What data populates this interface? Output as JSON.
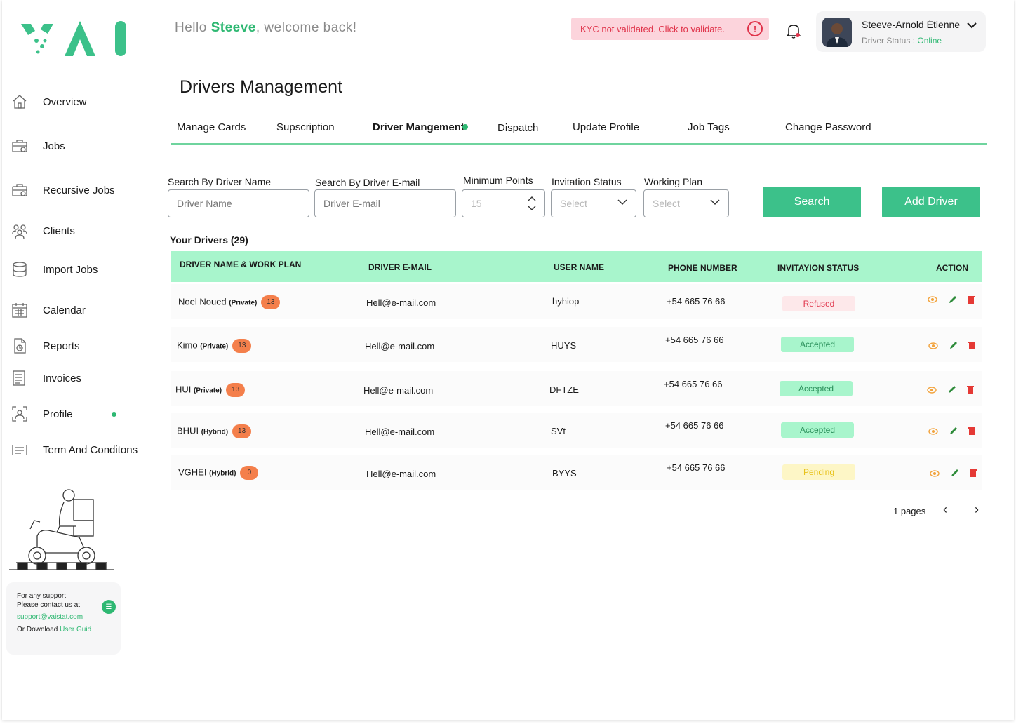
{
  "brand": {
    "logo_text": "VAI",
    "colors": {
      "accent": "#2eb872",
      "accent_light": "#a8f5cc",
      "button": "#3cc18a",
      "danger": "#e0334a",
      "warning_bg": "#fcd4dc"
    }
  },
  "sidebar": {
    "items": [
      {
        "label": "Overview",
        "icon": "home-icon"
      },
      {
        "label": "Jobs",
        "icon": "briefcase-icon"
      },
      {
        "label": "Recursive Jobs",
        "icon": "recurring-briefcase-icon"
      },
      {
        "label": "Clients",
        "icon": "users-icon"
      },
      {
        "label": "Import Jobs",
        "icon": "database-icon"
      },
      {
        "label": "Calendar",
        "icon": "calendar-icon"
      },
      {
        "label": "Reports",
        "icon": "report-icon"
      },
      {
        "label": "Invoices",
        "icon": "invoice-icon"
      },
      {
        "label": "Profile",
        "icon": "profile-icon"
      },
      {
        "label": "Term And Conditons",
        "icon": "terms-icon"
      }
    ],
    "support": {
      "line1": "For any support",
      "line2": "Please contact us at",
      "email": "support@vaistat.com",
      "download_prefix": "Or Download",
      "download_link": "User Guid"
    }
  },
  "header": {
    "greeting_prefix": "Hello ",
    "user_first_name": "Steeve",
    "greeting_suffix": ", welcome back!",
    "kyc_text": "KYC not validated. Click to validate.",
    "kyc_icon": "!",
    "profile": {
      "name": "Steeve-Arnold Étienne",
      "status_label": "Driver Status : ",
      "status_value": "Online"
    }
  },
  "page": {
    "title": "Drivers Management",
    "tabs": [
      {
        "label": "Manage Cards"
      },
      {
        "label": "Supscription"
      },
      {
        "label": "Driver Mangement",
        "active": true
      },
      {
        "label": "Dispatch"
      },
      {
        "label": "Update Profile"
      },
      {
        "label": "Job Tags"
      },
      {
        "label": "Change Password"
      }
    ]
  },
  "filters": {
    "driver_name": {
      "label": "Search By Driver Name",
      "placeholder": "Driver Name"
    },
    "driver_email": {
      "label": "Search By Driver E-mail",
      "placeholder": "Driver E-mail"
    },
    "min_points": {
      "label": "Minimum Points",
      "value": "15"
    },
    "invitation_status": {
      "label": "Invitation Status",
      "selected": "Select"
    },
    "working_plan": {
      "label": "Working Plan",
      "selected": "Select"
    },
    "search_button": "Search",
    "add_button": "Add Driver"
  },
  "table": {
    "title": "Your Drivers (29)",
    "headers": [
      "DRIVER NAME & WORK PLAN",
      "DRIVER E-MAIL",
      "USER NAME",
      "PHONE NUMBER",
      "INVITAYION STATUS",
      "ACTION"
    ],
    "rows": [
      {
        "name": "Noel Noued",
        "plan": "(Private)",
        "points": "13",
        "email": "Hell@e-mail.com",
        "username": "hyhiop",
        "phone": "+54 665 76 66",
        "status": "Refused"
      },
      {
        "name": "Kimo",
        "plan": "(Private)",
        "points": "13",
        "email": "Hell@e-mail.com",
        "username": "HUYS",
        "phone": "+54 665 76 66",
        "status": "Accepted"
      },
      {
        "name": "HUI",
        "plan": "(Private)",
        "points": "13",
        "email": "Hell@e-mail.com",
        "username": "DFTZE",
        "phone": "+54 665 76 66",
        "status": "Accepted"
      },
      {
        "name": "BHUI",
        "plan": "(Hybrid)",
        "points": "13",
        "email": "Hell@e-mail.com",
        "username": "SVt",
        "phone": "+54 665 76 66",
        "status": "Accepted"
      },
      {
        "name": "VGHEI",
        "plan": "(Hybrid)",
        "points": "0",
        "email": "Hell@e-mail.com",
        "username": "BYYS",
        "phone": "+54 665 76 66",
        "status": "Pending"
      }
    ],
    "actions": [
      "view-icon",
      "edit-icon",
      "delete-icon"
    ]
  },
  "pagination": {
    "text": "1 pages",
    "prev": "‹",
    "next": "›"
  }
}
